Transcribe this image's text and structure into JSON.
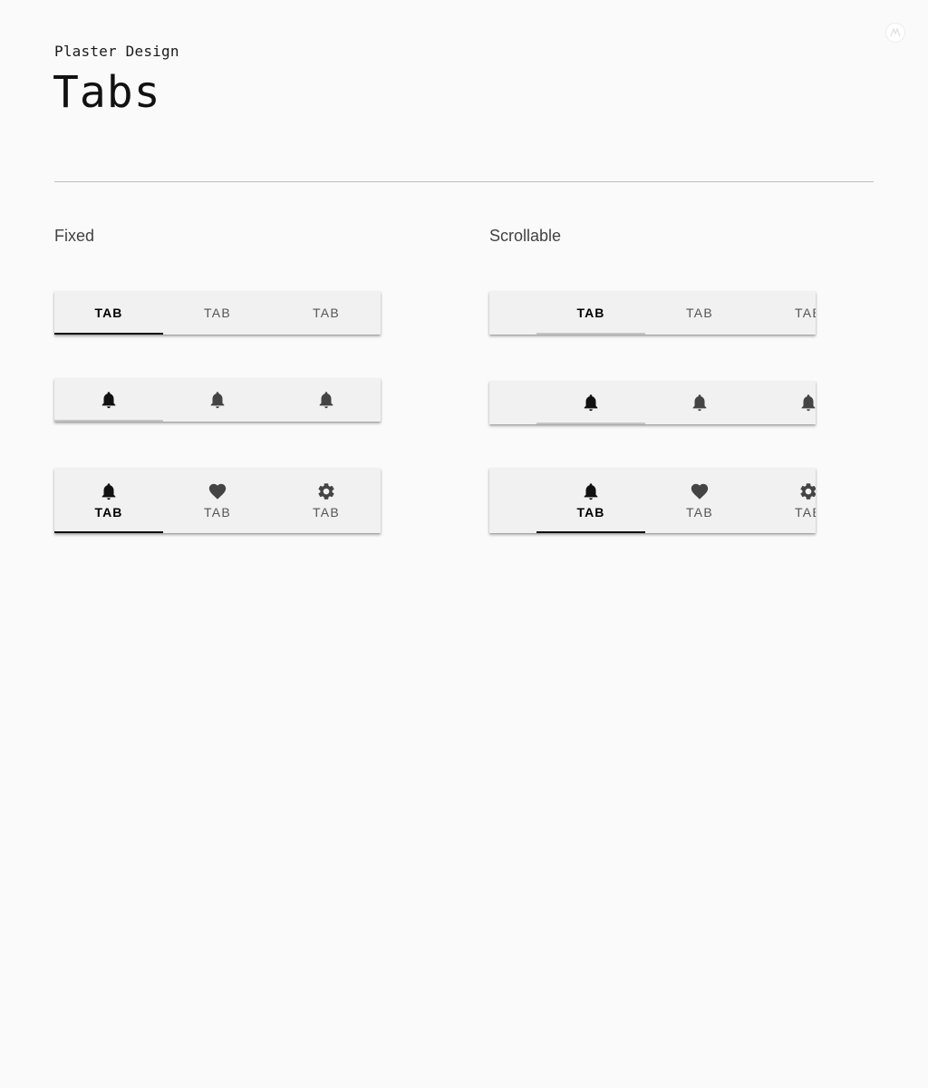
{
  "header": {
    "eyebrow": "Plaster Design",
    "title": "Tabs"
  },
  "sections": {
    "fixed": {
      "label": "Fixed",
      "text_tabs": [
        "TAB",
        "TAB",
        "TAB"
      ],
      "icon_tabs": [
        "bell-icon",
        "bell-icon",
        "bell-icon"
      ],
      "icon_text_tabs": [
        {
          "icon": "bell-icon",
          "label": "TAB"
        },
        {
          "icon": "heart-icon",
          "label": "TAB"
        },
        {
          "icon": "gear-icon",
          "label": "TAB"
        }
      ],
      "active_index": 0
    },
    "scrollable": {
      "label": "Scrollable",
      "text_tabs": [
        "TAB",
        "TAB",
        "TAB"
      ],
      "icon_tabs": [
        "bell-icon",
        "bell-icon",
        "bell-icon"
      ],
      "icon_text_tabs": [
        {
          "icon": "bell-icon",
          "label": "TAB"
        },
        {
          "icon": "heart-icon",
          "label": "TAB"
        },
        {
          "icon": "gear-icon",
          "label": "TAB"
        }
      ],
      "active_index": 0
    }
  },
  "colors": {
    "background": "#fafafa",
    "tabbar": "#f1f1f1",
    "active_text": "#000000",
    "inactive_text": "#555555",
    "indicator": "#111111"
  }
}
